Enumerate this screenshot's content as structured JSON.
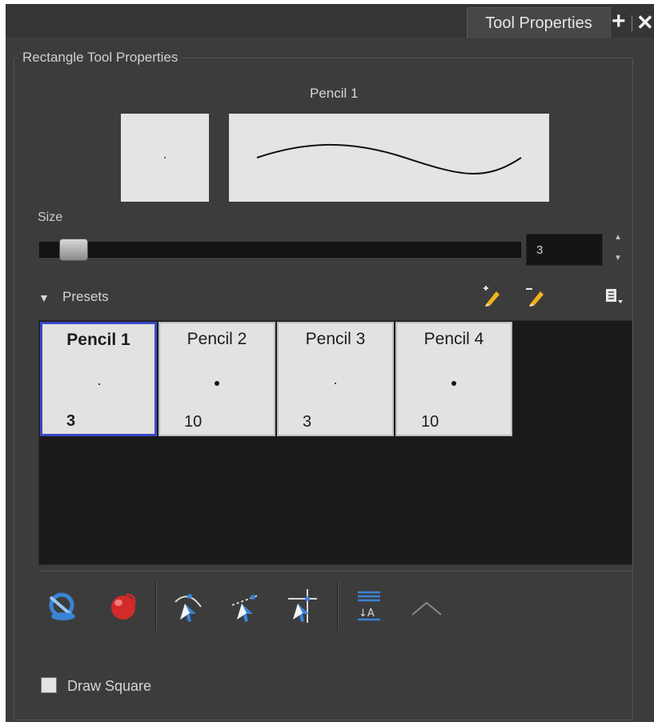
{
  "tab_bar": {
    "tab_label": "Tool Properties",
    "add_icon": "plus-icon",
    "close_icon": "close-icon"
  },
  "group": {
    "title": "Rectangle Tool Properties"
  },
  "brush": {
    "name": "Pencil 1"
  },
  "size": {
    "label": "Size",
    "value": "3",
    "slider_fraction": 0.04
  },
  "presets": {
    "label": "Presets",
    "tools": [
      "new-preset-icon",
      "delete-preset-icon",
      "preset-menu-icon"
    ],
    "items": [
      {
        "name": "Pencil 1",
        "size": "3",
        "selected": true
      },
      {
        "name": "Pencil 2",
        "size": "10",
        "selected": false
      },
      {
        "name": "Pencil 3",
        "size": "3",
        "selected": false
      },
      {
        "name": "Pencil 4",
        "size": "10",
        "selected": false
      }
    ]
  },
  "toolbar": {
    "icons": [
      "auto-flatten-icon",
      "auto-create-color-art-icon",
      "snap-to-contour-icon",
      "snap-and-align-icon",
      "snap-to-grid-icon",
      "arrange-forward-icon",
      "join-style-icon"
    ]
  },
  "draw_square": {
    "label": "Draw Square",
    "checked": false
  },
  "colors": {
    "panel": "#3c3c3c",
    "selection": "#3a49c9",
    "preset_bg": "#e2e2e2",
    "icon_blue": "#3b83d6",
    "icon_red": "#d32a2a"
  }
}
